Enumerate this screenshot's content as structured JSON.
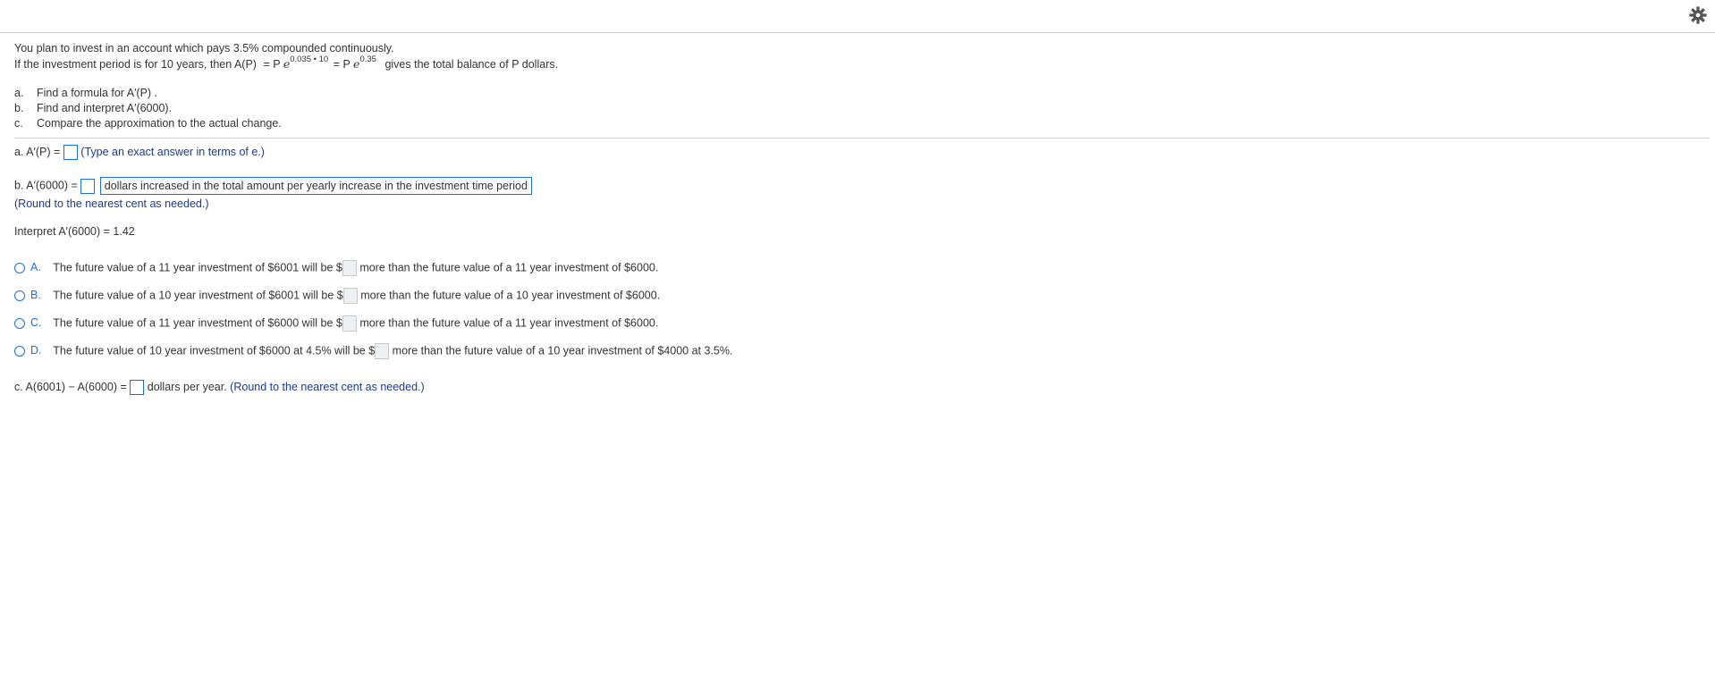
{
  "toolbar": {
    "gear_icon": "gear-icon"
  },
  "problem": {
    "line1": "You plan to invest in an account which pays 3.5% compounded continuously.",
    "line2_pre": "If the investment period is for 10 years, then A(P)",
    "eq1_lhs": "= P",
    "eq1_e": "e",
    "eq1_exp": "0.035 • 10",
    "eq2_lhs": "= P",
    "eq2_e": "e",
    "eq2_exp": "0.35",
    "line2_post": "gives the total balance of P dollars."
  },
  "parts": [
    {
      "letter": "a.",
      "text": "Find a formula for A′(P) ."
    },
    {
      "letter": "b.",
      "text": "Find and interpret A′(6000)."
    },
    {
      "letter": "c.",
      "text": "Compare the approximation to the actual change."
    }
  ],
  "answer_a": {
    "label": "a. A′(P) =",
    "hint": "(Type an exact answer in terms of e.)"
  },
  "answer_b": {
    "label": "b. A′(6000) =",
    "dropdown_value": "dollars increased in the total amount per yearly increase in the investment time period",
    "hint": "(Round to the nearest cent as needed.)"
  },
  "interpret": {
    "text": "Interpret A′(6000) = 1.42"
  },
  "options": [
    {
      "letter": "A.",
      "pre": "The future value of a 11 year investment of $6001 will be $",
      "post": "more than the future value of a 11 year investment of $6000."
    },
    {
      "letter": "B.",
      "pre": "The future value of a 10 year investment of $6001 will be $",
      "post": "more than the future value of a 10 year investment of $6000."
    },
    {
      "letter": "C.",
      "pre": "The future value of a 11 year investment of $6000 will be $",
      "post": "more than the future value of a 11 year investment of $6000."
    },
    {
      "letter": "D.",
      "pre": "The future value of 10 year investment of $6000 at 4.5% will be $",
      "post": "more than the future value of a 10 year investment of $4000 at 3.5%."
    }
  ],
  "answer_c": {
    "label": "c. A(6001) − A(6000) =",
    "unit": "dollars per year.",
    "hint": "(Round to the nearest cent as needed.)"
  }
}
